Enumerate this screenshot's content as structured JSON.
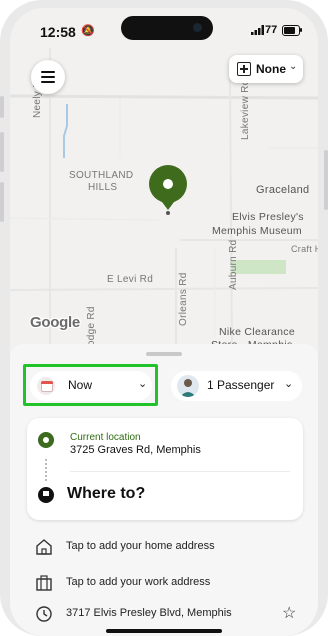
{
  "status_bar": {
    "time": "12:58",
    "dnd_icon": "bell-slash-icon",
    "battery": "77"
  },
  "map": {
    "labels": {
      "neely_rd": "Neely Rd",
      "lakeview_rd": "Lakeview Rd",
      "southland": "SOUTHLAND",
      "hills": "HILLS",
      "graceland": "Graceland",
      "elvis_museum_1": "Elvis Presley's",
      "elvis_museum_2": "Memphis Museum",
      "craft": "Craft H",
      "e_levi": "E Levi Rd",
      "orleans": "Orleans Rd",
      "auburn": "Auburn Rd",
      "lodge": "Lodge Rd",
      "nike_1": "Nike Clearance",
      "nike_2": "Store - Memphis"
    },
    "google_logo": "Google",
    "pin_color": "#3e6b1c"
  },
  "top_controls": {
    "menu_icon": "hamburger-menu-icon",
    "ride_filter_label": "None"
  },
  "sheet": {
    "time_selector": "Now",
    "passengers": "1 Passenger",
    "current_location_label": "Current location",
    "current_location_address": "3725 Graves Rd, Memphis",
    "destination_prompt": "Where to?",
    "shortcuts": [
      {
        "icon": "home-icon",
        "label": "Tap to add your home address"
      },
      {
        "icon": "briefcase-icon",
        "label": "Tap to add your work address"
      },
      {
        "icon": "clock-icon",
        "label": "3717 Elvis Presley Blvd, Memphis"
      }
    ]
  },
  "colors": {
    "highlight": "#22c32a",
    "accent_green": "#3c6a1f"
  }
}
